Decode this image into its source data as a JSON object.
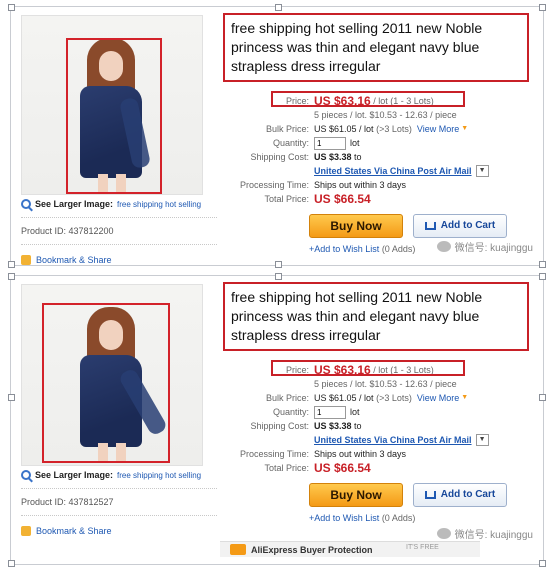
{
  "listings": [
    {
      "title": "free shipping hot selling 2011 new Noble princess was thin and elegant navy blue strapless dress irregular",
      "larger_label": "See Larger Image:",
      "larger_link": "free shipping hot selling",
      "product_id": "Product ID: 437812200",
      "bookmark": "Bookmark & Share",
      "price_label": "Price:",
      "price_value": "US $63.16",
      "price_unit": "/ lot",
      "price_lots": "(1 - 3 Lots)",
      "pieces": "5 pieces / lot. $10.53 - 12.63 / piece",
      "bulk_label": "Bulk Price:",
      "bulk_value": "US $61.05",
      "bulk_unit": "/ lot",
      "bulk_lots": "(>3 Lots)",
      "view_more": "View More",
      "qty_label": "Quantity:",
      "qty_value": "1",
      "qty_unit": "lot",
      "ship_label": "Shipping Cost:",
      "ship_value": "US $3.38",
      "ship_to": "to",
      "ship_method": "United States Via China Post Air Mail",
      "proc_label": "Processing Time:",
      "proc_value": "Ships out within 3 days",
      "total_label": "Total Price:",
      "total_value": "US $66.54",
      "buy_label": "Buy Now",
      "cart_label": "Add to Cart",
      "wish_label": "+Add to Wish List",
      "wish_count": "(0 Adds)",
      "watermark": "微信号: kuajinggu"
    },
    {
      "title": "free shipping hot selling 2011 new Noble princess was thin and elegant navy blue strapless dress irregular",
      "larger_label": "See Larger Image:",
      "larger_link": "free shipping hot selling",
      "product_id": "Product ID: 437812527",
      "bookmark": "Bookmark & Share",
      "price_label": "Price:",
      "price_value": "US $63.16",
      "price_unit": "/ lot",
      "price_lots": "(1 - 3 Lots)",
      "pieces": "5 pieces / lot. $10.53 - 12.63 / piece",
      "bulk_label": "Bulk Price:",
      "bulk_value": "US $61.05",
      "bulk_unit": "/ lot",
      "bulk_lots": "(>3 Lots)",
      "view_more": "View More",
      "qty_label": "Quantity:",
      "qty_value": "1",
      "qty_unit": "lot",
      "ship_label": "Shipping Cost:",
      "ship_value": "US $3.38",
      "ship_to": "to",
      "ship_method": "United States Via China Post Air Mail",
      "proc_label": "Processing Time:",
      "proc_value": "Ships out within 3 days",
      "total_label": "Total Price:",
      "total_value": "US $66.54",
      "buy_label": "Buy Now",
      "cart_label": "Add to Cart",
      "wish_label": "+Add to Wish List",
      "wish_count": "(0 Adds)",
      "watermark": "微信号: kuajinggu"
    }
  ],
  "footer": {
    "protection": "AliExpress Buyer Protection",
    "free_text": "IT'S FREE"
  },
  "icons": {
    "magnifier": "magnifier-icon",
    "bookmark": "bookmark-icon",
    "cart": "cart-icon",
    "dropdown": "chevron-down-icon",
    "wechat": "wechat-icon"
  },
  "colors": {
    "highlight_red": "#c82027",
    "price_red": "#c82027",
    "link_blue": "#1e58b2",
    "buy_orange": "#f49a16"
  }
}
